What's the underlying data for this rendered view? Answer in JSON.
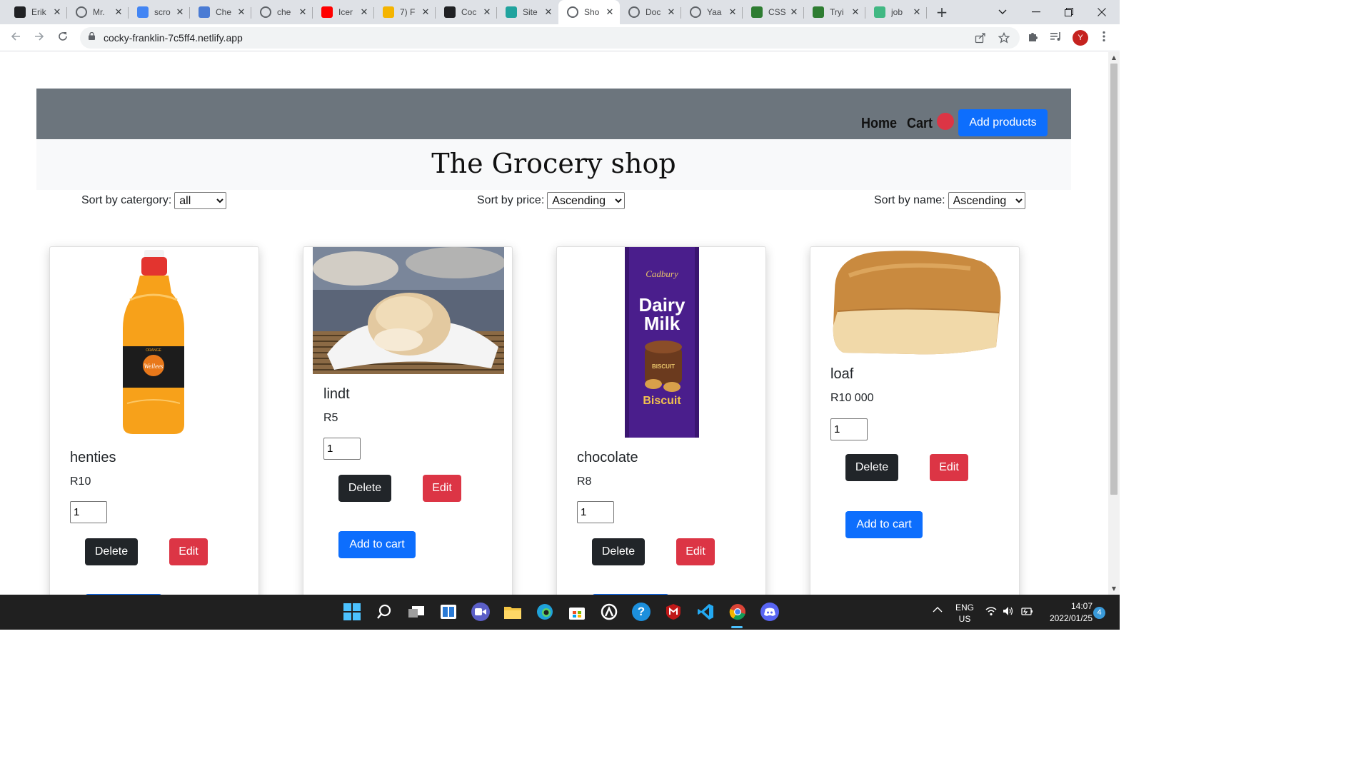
{
  "browser": {
    "tabs": [
      {
        "label": "Erik",
        "icon": "star-logo-icon",
        "color": "#202124"
      },
      {
        "label": "Mr.",
        "icon": "globe-icon",
        "color": "#5f6368"
      },
      {
        "label": "scro",
        "icon": "google-icon",
        "color": "#4285f4"
      },
      {
        "label": "Che",
        "icon": "flag-icon",
        "color": "#4a7bd4"
      },
      {
        "label": "che",
        "icon": "globe-icon",
        "color": "#5f6368"
      },
      {
        "label": "Icer",
        "icon": "youtube-icon",
        "color": "#ff0000"
      },
      {
        "label": "7) F",
        "icon": "drive-icon",
        "color": "#f4b400"
      },
      {
        "label": "Coc",
        "icon": "codepen-icon",
        "color": "#202124"
      },
      {
        "label": "Site",
        "icon": "netlify-icon",
        "color": "#20a39e"
      },
      {
        "label": "Sho",
        "icon": "globe-icon",
        "color": "#5f6368"
      },
      {
        "label": "Doc",
        "icon": "globe-icon",
        "color": "#5f6368"
      },
      {
        "label": "Yaa",
        "icon": "globe-icon",
        "color": "#5f6368"
      },
      {
        "label": "CSS",
        "icon": "w3schools-icon",
        "color": "#2e7d32"
      },
      {
        "label": "Tryi",
        "icon": "w3schools-icon",
        "color": "#2e7d32"
      },
      {
        "label": "job",
        "icon": "vue-icon",
        "color": "#41b883"
      }
    ],
    "active_tab": 9,
    "url": "cocky-franklin-7c5ff4.netlify.app",
    "profile_initial": "Y"
  },
  "page": {
    "nav": {
      "home": "Home",
      "cart": "Cart",
      "add_products": "Add products"
    },
    "title": "The Grocery shop",
    "sort": {
      "category": {
        "label": "Sort by catergory:",
        "value": "all"
      },
      "price": {
        "label": "Sort by price:",
        "value": "Ascending"
      },
      "name": {
        "label": "Sort by name:",
        "value": "Ascending"
      }
    },
    "buttons": {
      "delete": "Delete",
      "edit": "Edit",
      "add_to_cart": "Add to cart"
    },
    "products": [
      {
        "name": "henties",
        "price": "R10",
        "qty": "1",
        "image": "orange-juice-bottle"
      },
      {
        "name": "lindt",
        "price": "R5",
        "qty": "1",
        "image": "bread-roll"
      },
      {
        "name": "chocolate",
        "price": "R8",
        "qty": "1",
        "image": "dairy-milk-biscuit-bar"
      },
      {
        "name": "loaf",
        "price": "R10 000",
        "qty": "1",
        "image": "bread-loaf"
      }
    ],
    "image_text": {
      "juice_brand": "Wellees",
      "juice_flavor": "ORANGE",
      "choc_brand": "Cadbury",
      "choc_line1": "Dairy",
      "choc_line2": "Milk",
      "choc_flavor": "Biscuit",
      "choc_biscuit": "BISCUIT"
    }
  },
  "taskbar": {
    "lang": "ENG",
    "region": "US",
    "time": "14:07",
    "date": "2022/01/25",
    "notifications": "4"
  }
}
